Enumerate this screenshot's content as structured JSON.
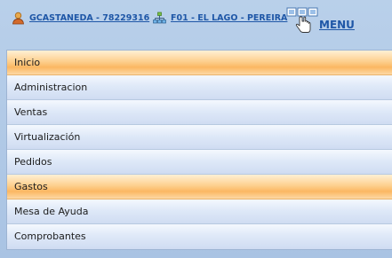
{
  "header": {
    "user_link": "GCASTANEDA - 78229316",
    "branch_link": "F01 - EL LAGO - PEREIRA",
    "menu_label": "MENU",
    "icons": {
      "user": "user-icon",
      "branch": "network-icon",
      "menu": "hand-pointer-menu-icon"
    }
  },
  "menu": {
    "items": [
      {
        "label": "Inicio",
        "active": true
      },
      {
        "label": "Administracion",
        "active": false
      },
      {
        "label": "Ventas",
        "active": false
      },
      {
        "label": "Virtualización",
        "active": false
      },
      {
        "label": "Pedidos",
        "active": false
      },
      {
        "label": "Gastos",
        "active": true
      },
      {
        "label": "Mesa de Ayuda",
        "active": false
      },
      {
        "label": "Comprobantes",
        "active": false
      }
    ]
  },
  "colors": {
    "background": "#b9d0ea",
    "link": "#1f57a7",
    "highlight": "#fbb762",
    "item_bg": "#dfe9f8"
  }
}
